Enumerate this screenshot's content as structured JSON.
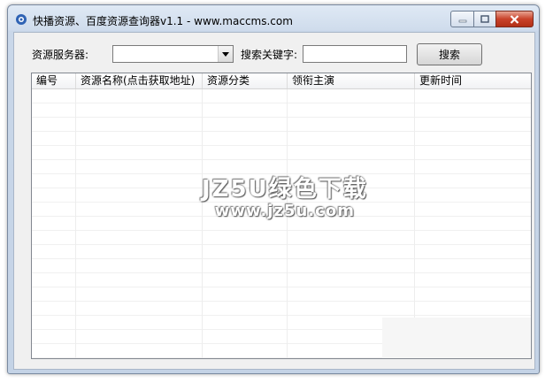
{
  "window": {
    "title": "快播资源、百度资源查询器v1.1 - www.maccms.com",
    "buttons": {
      "minimize": "minimize-icon",
      "maximize": "maximize-icon",
      "close": "close-icon"
    }
  },
  "toolbar": {
    "server_label": "资源服务器:",
    "server_value": "",
    "keyword_label": "搜索关键字:",
    "keyword_value": "",
    "search_button": "搜索"
  },
  "table": {
    "columns": [
      "编号",
      "资源名称(点击获取地址)",
      "资源分类",
      "领衔主演",
      "更新时间"
    ],
    "rows": []
  },
  "watermark": {
    "line1": "JZ5U绿色下载",
    "line2": "www.jz5u.com"
  }
}
